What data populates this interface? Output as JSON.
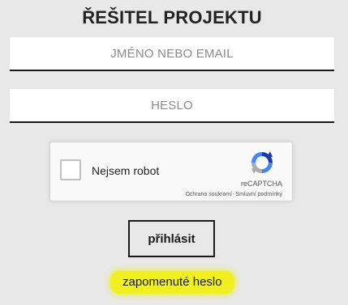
{
  "page": {
    "title": "ŘEŠITEL PROJEKTU"
  },
  "login_form": {
    "username_placeholder": "JMÉNO NEBO EMAIL",
    "password_placeholder": "HESLO",
    "username_value": "",
    "password_value": "",
    "submit_label": "přihlásit",
    "forgot_label": "zapomenuté heslo"
  },
  "captcha": {
    "label": "Nejsem robot",
    "brand": "reCAPTCHA",
    "privacy_label": "Ochrana soukromí",
    "separator": "-",
    "terms_label": "Smluvní podmínky",
    "checked": false,
    "logo_icon": "recaptcha-logo-icon"
  },
  "colors": {
    "background": "#e8e8e8",
    "highlight": "#f0f020",
    "text": "#1a1a1a"
  }
}
